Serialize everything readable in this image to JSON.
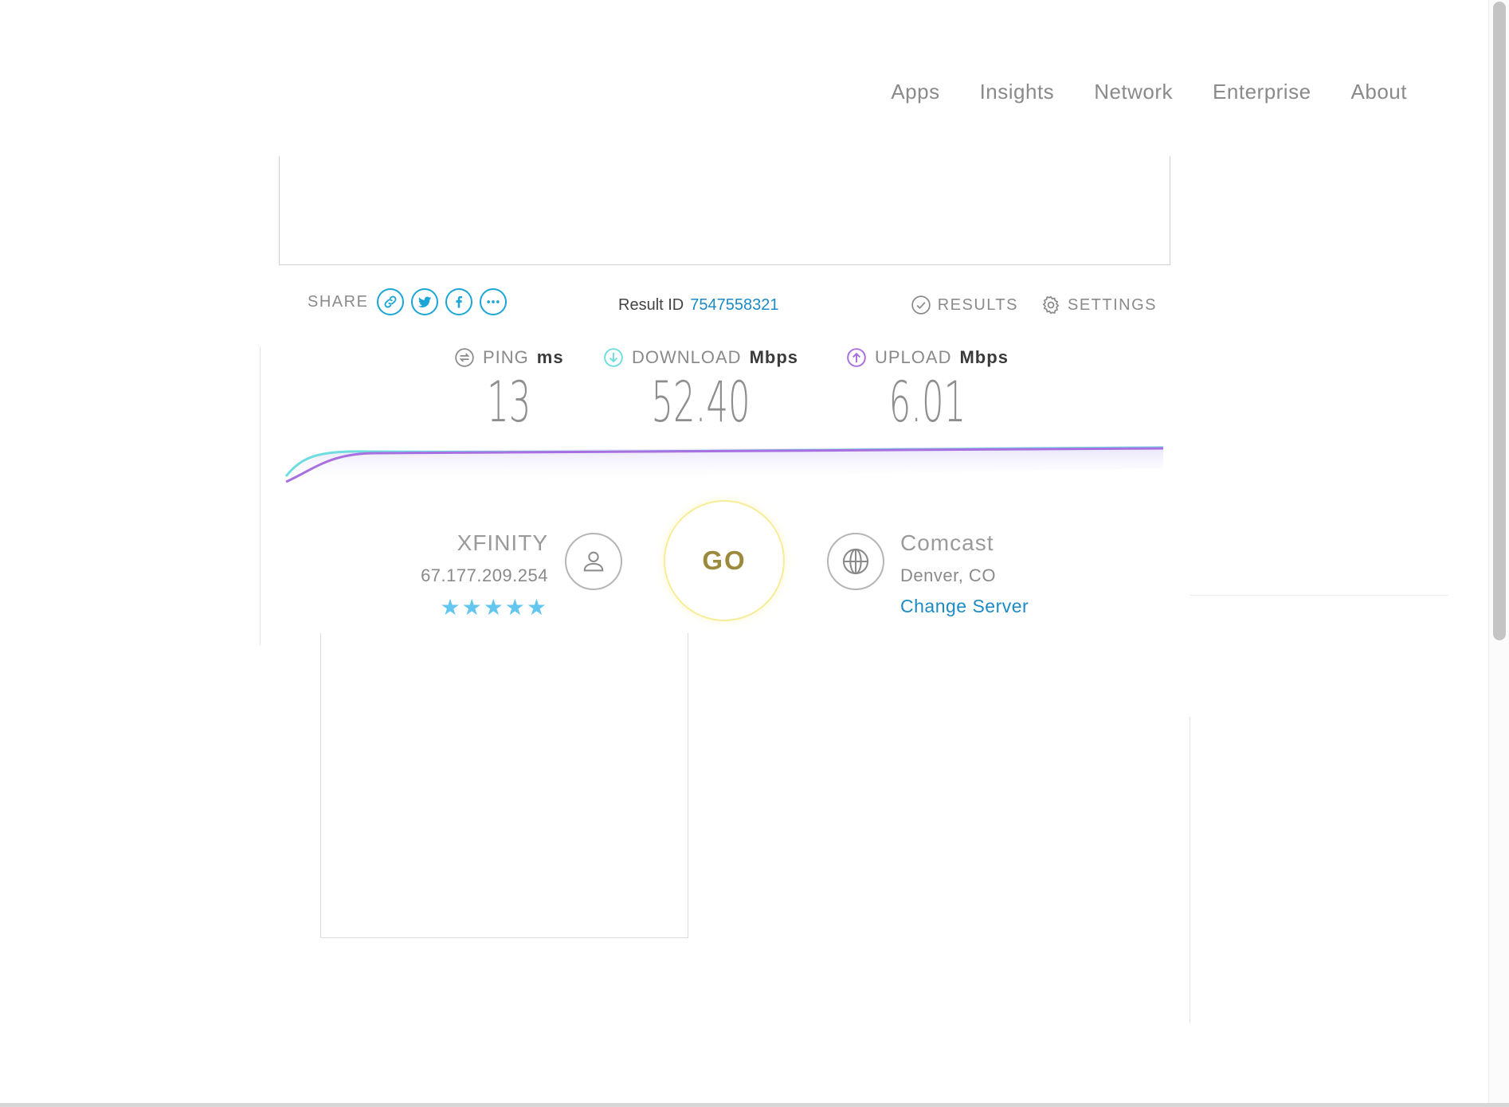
{
  "nav": {
    "items": [
      {
        "label": "Apps"
      },
      {
        "label": "Insights"
      },
      {
        "label": "Network"
      },
      {
        "label": "Enterprise"
      },
      {
        "label": "About"
      }
    ]
  },
  "share": {
    "label": "SHARE",
    "buttons": [
      "link-icon",
      "twitter-icon",
      "facebook-icon",
      "more-icon"
    ]
  },
  "result": {
    "label": "Result ID",
    "id": "7547558321"
  },
  "actions": {
    "results_label": "RESULTS",
    "settings_label": "SETTINGS"
  },
  "metrics": {
    "ping": {
      "name": "PING",
      "unit": "ms",
      "value": "13"
    },
    "download": {
      "name": "DOWNLOAD",
      "unit": "Mbps",
      "value": "52.40"
    },
    "upload": {
      "name": "UPLOAD",
      "unit": "Mbps",
      "value": "6.01"
    }
  },
  "isp": {
    "name": "XFINITY",
    "ip": "67.177.209.254",
    "rating": 5,
    "stars": "★★★★★"
  },
  "go": {
    "label": "GO"
  },
  "server": {
    "name": "Comcast",
    "location": "Denver, CO",
    "change_label": "Change Server"
  },
  "colors": {
    "accent": "#1ba6d6",
    "link": "#1b8ac6",
    "download_line": "#6fdde0",
    "upload_line": "#a86fe0",
    "go_ring": "#f7ed99",
    "stars": "#62c6ef"
  }
}
